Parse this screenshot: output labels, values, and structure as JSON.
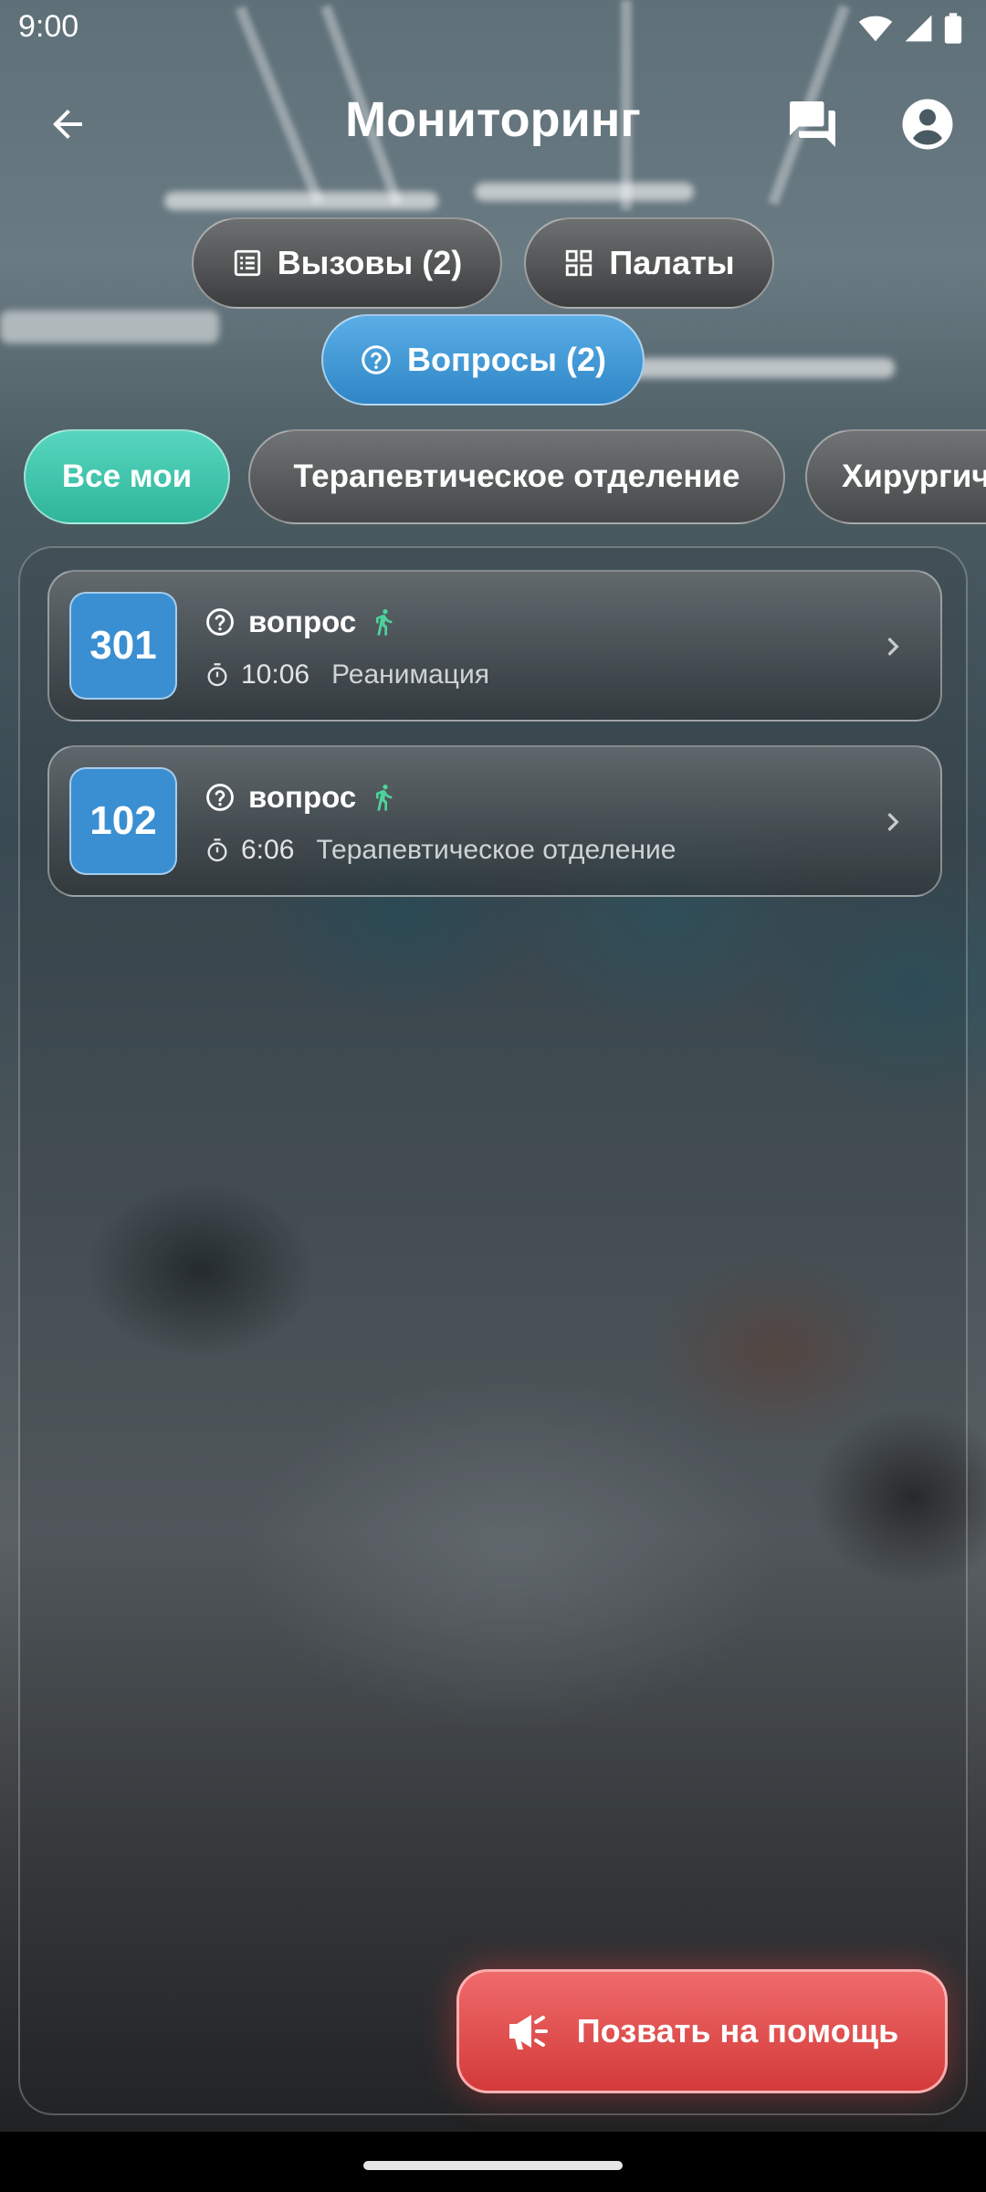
{
  "status_bar": {
    "time": "9:00"
  },
  "app_bar": {
    "title": "Мониторинг"
  },
  "tabs": [
    {
      "label": "Вызовы (2)",
      "icon": "list-icon",
      "active": false
    },
    {
      "label": "Палаты",
      "icon": "grid-icon",
      "active": false
    },
    {
      "label": "Вопросы (2)",
      "icon": "question-circle-icon",
      "active": true
    }
  ],
  "filters": [
    {
      "label": "Все мои",
      "active": true
    },
    {
      "label": "Терапевтическое отделение",
      "active": false
    },
    {
      "label": "Хирургич",
      "active": false
    }
  ],
  "requests": [
    {
      "room": "301",
      "type": "вопрос",
      "time": "10:06",
      "department": "Реанимация"
    },
    {
      "room": "102",
      "type": "вопрос",
      "time": "6:06",
      "department": "Терапевтическое отделение"
    }
  ],
  "help_button": {
    "label": "Позвать на помощь"
  },
  "colors": {
    "tab_active": "#3a8fd3",
    "chip_active": "#3cc4ab",
    "room_badge": "#3a8fd3",
    "help_button": "#e04848",
    "walking_icon": "#4cd39a"
  }
}
